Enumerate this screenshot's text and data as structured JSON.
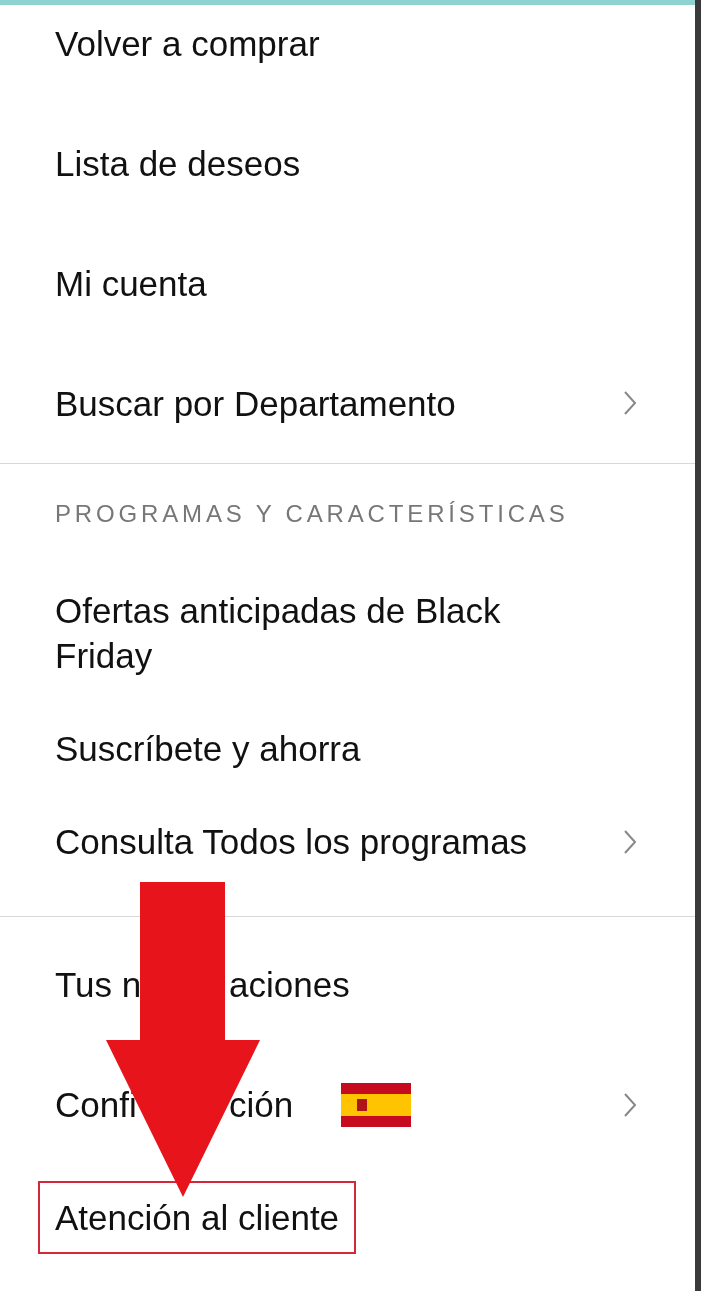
{
  "sections": [
    {
      "items": [
        {
          "label": "Volver a comprar",
          "chevron": false
        },
        {
          "label": "Lista de deseos",
          "chevron": false
        },
        {
          "label": "Mi cuenta",
          "chevron": false
        },
        {
          "label": "Buscar por Departamento",
          "chevron": true
        }
      ]
    },
    {
      "heading": "PROGRAMAS Y CARACTERÍSTICAS",
      "items": [
        {
          "label": "Ofertas anticipadas de Black Friday",
          "chevron": false
        },
        {
          "label": "Suscríbete y ahorra",
          "chevron": false
        },
        {
          "label": "Consulta Todos los programas",
          "chevron": true
        }
      ]
    },
    {
      "items": [
        {
          "label_parts": [
            "Tus n",
            "aciones"
          ],
          "chevron": false
        },
        {
          "label_parts": [
            "Confi",
            "ción"
          ],
          "chevron": true,
          "flag": true
        },
        {
          "label": "Atención al cliente",
          "chevron": false,
          "highlighted": true
        }
      ]
    }
  ],
  "annotation": {
    "kind": "arrow"
  }
}
